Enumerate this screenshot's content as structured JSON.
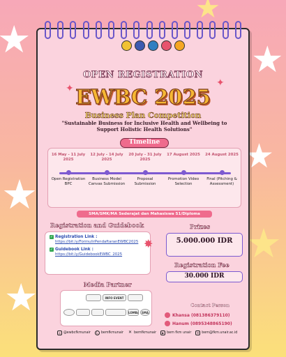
{
  "poster": {
    "heading": "OPEN REGISTRATION",
    "title": "EWBC 2025",
    "subtitle": "Business Plan Competition",
    "tagline": "\"Sustainable Business for Inclusive Health and Wellbeing to Support Holistic Health Solutions\""
  },
  "timeline": {
    "title": "Timeline",
    "items": [
      {
        "date": "16 May - 11 July 2025",
        "event": "Open Registration BPC"
      },
      {
        "date": "12 July - 14 July 2025",
        "event": "Business Model Canvas Submission"
      },
      {
        "date": "20 July - 31 July 2025",
        "event": "Proposal Submission"
      },
      {
        "date": "17 August 2025",
        "event": "Promotion Video Selection"
      },
      {
        "date": "24 August 2025",
        "event": "Final (Pitching & Assessment)"
      }
    ]
  },
  "eligibility": "SMA/SMK/MA Sederajat dan Mahasiswa S1/Diploma",
  "registration": {
    "title": "Registration and Guidebook",
    "reg_label": "Registration Link :",
    "reg_link": "https://bit.ly/FormulirPendaftaranEWBC2025",
    "guide_label": "Guidebook Link :",
    "guide_link": "https://bit.ly/GuidebookEWBC_2025"
  },
  "prizes": {
    "title": "Prizes",
    "amount": "5.000.000 IDR"
  },
  "fee": {
    "title": "Registration Fee",
    "amount": "30.000 IDR"
  },
  "media_partner": {
    "title": "Media Partner",
    "partners": [
      "INFO EVENT",
      "LOMBA",
      "SMA"
    ]
  },
  "contact": {
    "title": "Contact Person",
    "persons": [
      "Khansa (081386379110)",
      "Hanum (0895348865190)"
    ]
  },
  "footer": {
    "instagram": "@ewbcfkmunair",
    "line": "bemfkmunair",
    "x": "bemfkmunair",
    "youtube": "bem fkm unair",
    "email": "bem@fkm.unair.ac.id"
  },
  "colors": {
    "accent_pink": "#ef6b8d",
    "title_gold": "#f6b733",
    "spiral_purple": "#6b57c9"
  }
}
